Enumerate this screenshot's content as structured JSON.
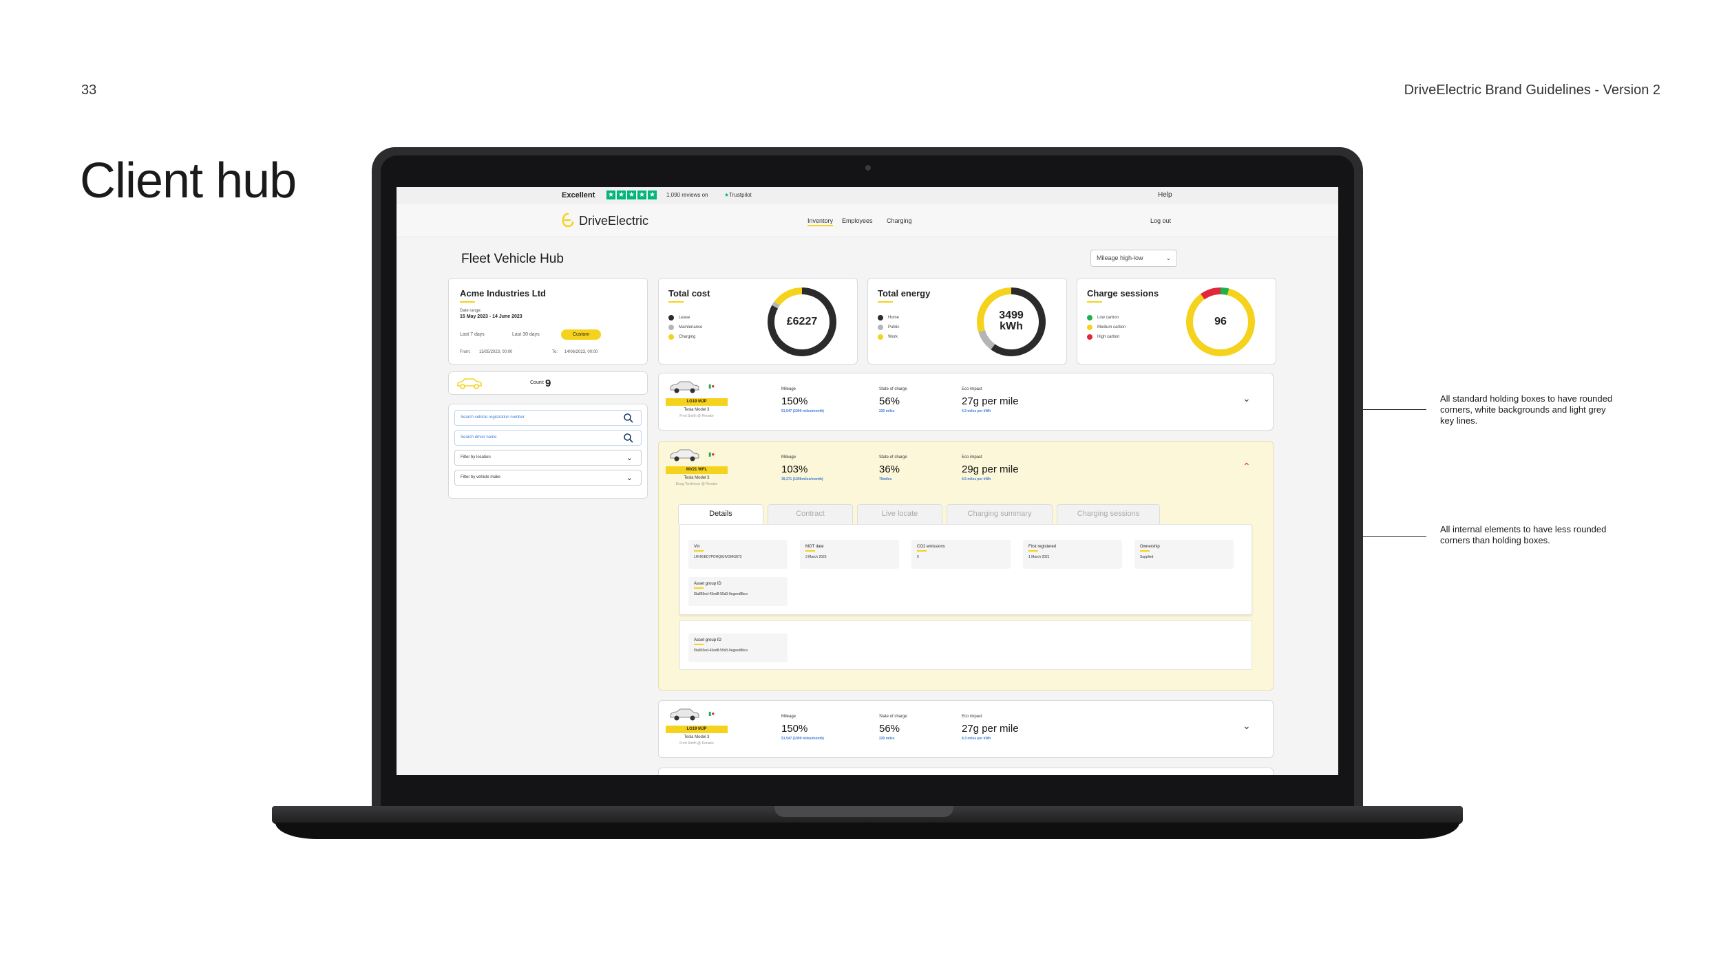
{
  "slide": {
    "page_number": "33",
    "doc_title": "DriveElectric Brand Guidelines - Version 2",
    "section_title": "Client hub"
  },
  "annotations": [
    "All standard holding boxes to have rounded corners, white backgrounds and light grey key lines.",
    "All internal elements to have less rounded corners than holding boxes."
  ],
  "trustpilot": {
    "rating_label": "Excellent",
    "reviews": "1,090 reviews on",
    "brand": "Trustpilot",
    "star_color": "#00b67a"
  },
  "nav": {
    "logo": "DriveElectric",
    "help": "Help",
    "links": [
      "Inventory",
      "Employees",
      "Charging"
    ],
    "active": "Inventory",
    "logout": "Log out"
  },
  "hub": {
    "title": "Fleet Vehicle Hub",
    "sort": "Mileage high-low"
  },
  "client": {
    "name": "Acme Industries Ltd",
    "date_range_label": "Date range:",
    "date_range": "15 May 2023 - 14 June 2023",
    "last_7": "Last 7 days",
    "last_30": "Last 30 days",
    "custom": "Custom",
    "from_label": "From:",
    "from": "15/05/2023, 00:00",
    "to_label": "To:",
    "to": "14/06/2023, 00:00"
  },
  "stats": {
    "total_cost": {
      "title": "Total cost",
      "value": "£6227",
      "legend": [
        {
          "label": "Lease",
          "color": "#2b2b2b"
        },
        {
          "label": "Maintenance",
          "color": "#b5b5b5"
        },
        {
          "label": "Charging",
          "color": "#f5d21b"
        }
      ],
      "shares": [
        0.83,
        0.02,
        0.15
      ]
    },
    "total_energy": {
      "title": "Total energy",
      "value_line1": "3499",
      "value_line2": "kWh",
      "legend": [
        {
          "label": "Home",
          "color": "#2b2b2b"
        },
        {
          "label": "Public",
          "color": "#b5b5b5"
        },
        {
          "label": "Work",
          "color": "#f5d21b"
        }
      ],
      "shares": [
        0.6,
        0.1,
        0.3
      ]
    },
    "charge_sessions": {
      "title": "Charge sessions",
      "value": "96",
      "legend": [
        {
          "label": "Low carbon",
          "color": "#20b14c"
        },
        {
          "label": "Medium carbon",
          "color": "#f5d21b"
        },
        {
          "label": "High carbon",
          "color": "#e0283a"
        }
      ],
      "shares": [
        0.04,
        0.86,
        0.1
      ]
    }
  },
  "sidebar": {
    "count_label": "Count:",
    "count": "9",
    "search_reg": "Search vehicle registration number",
    "search_driver": "Search driver name",
    "filter_location": "Filter by location",
    "filter_make": "Filter by vehicle make"
  },
  "vehicles": [
    {
      "plate": "LG19 MJP",
      "model": "Tesla Model 3",
      "driver": "Fred Smith @ Renake",
      "mileage_label": "Mileage",
      "mileage": "150%",
      "mileage_sub": "51,547 (1000 miles/month)",
      "charge_label": "State of charge",
      "charge": "56%",
      "charge_sub": "220 miles",
      "eco_label": "Eco impact",
      "eco": "27g per mile",
      "eco_sub": "4.3 miles per kWh"
    },
    {
      "plate": "MV21 WFL",
      "model": "Tesla Model 3",
      "driver": "Doug Tomlinson @ Renake",
      "mileage_label": "Mileage",
      "mileage": "103%",
      "mileage_sub": "39,271 (1396miles/month)",
      "charge_label": "State of charge",
      "charge": "36%",
      "charge_sub": "75miles",
      "eco_label": "Eco impact",
      "eco": "29g per mile",
      "eco_sub": "4.5 miles per kWh"
    },
    {
      "plate": "LG19 MJP",
      "model": "Tesla Model 3",
      "driver": "Fred Smith @ Renake",
      "mileage_label": "Mileage",
      "mileage": "150%",
      "mileage_sub": "51,547 (1000 miles/month)",
      "charge_label": "State of charge",
      "charge": "56%",
      "charge_sub": "220 miles",
      "eco_label": "Eco impact",
      "eco": "27g per mile",
      "eco_sub": "4.3 miles per kWh"
    }
  ],
  "detail": {
    "tabs": [
      "Details",
      "Contract",
      "Live locate",
      "Charging summary",
      "Charging sessions"
    ],
    "active_tab": "Details",
    "fields": [
      {
        "label": "Vin",
        "value": "LHHKIED7POHQ8JIVGMG873"
      },
      {
        "label": "MOT date",
        "value": "3 March 2023"
      },
      {
        "label": "CO2 emissions",
        "value": "0"
      },
      {
        "label": "First registered",
        "value": "1 March 2021"
      },
      {
        "label": "Ownership",
        "value": "Supplied"
      },
      {
        "label": "Asset group ID",
        "value": "f3a893ed-43ed8-55d3-0egeed8bcv"
      }
    ],
    "extra_field": {
      "label": "Asset group ID",
      "value": "f3a893ed-43ed8-55d3-0egeed8bcv"
    }
  },
  "colors": {
    "accent": "#f5d21b",
    "link": "#3b7bd8",
    "expanded_bg": "#fdf7d9"
  }
}
